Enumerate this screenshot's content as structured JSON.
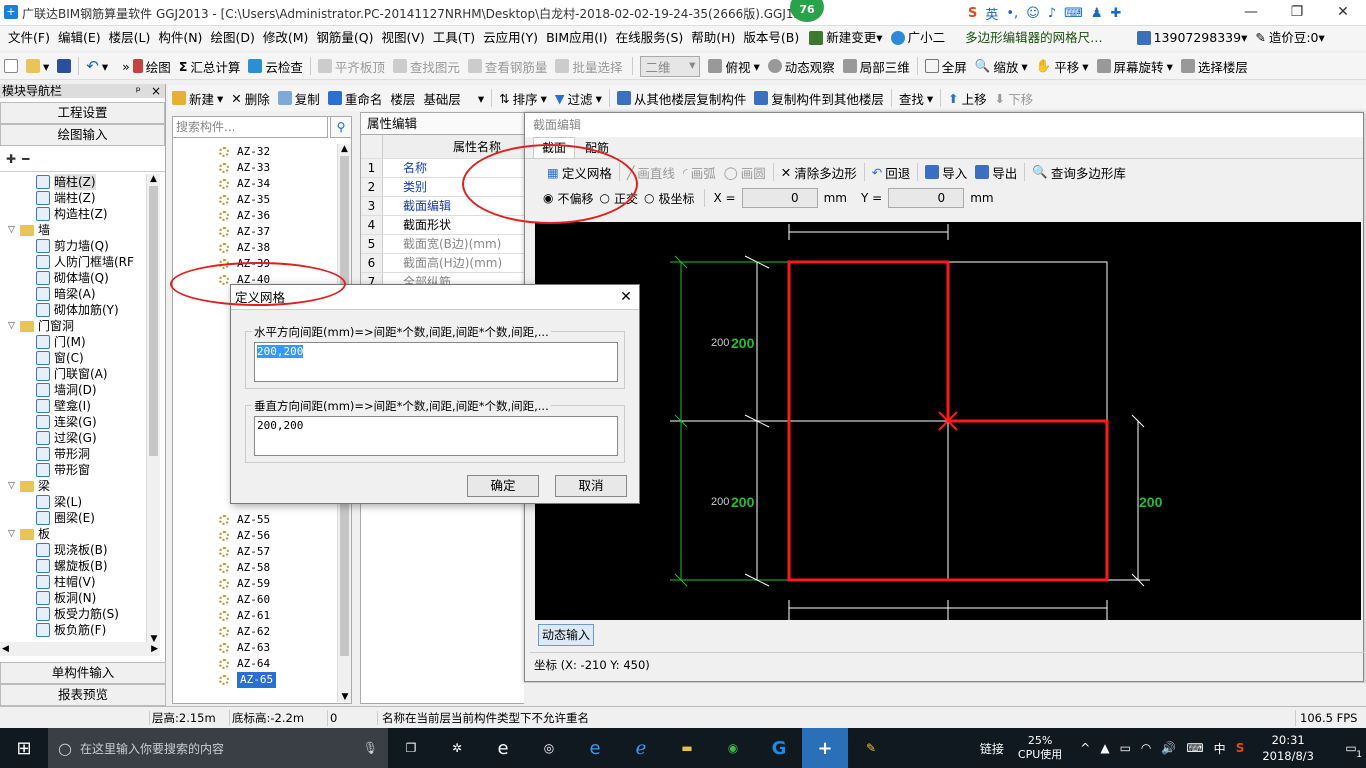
{
  "titlebar": {
    "title": "广联达BIM钢筋算量软件 GGJ2013 - [C:\\Users\\Administrator.PC-20141127NRHM\\Desktop\\白龙村-2018-02-02-19-24-35(2666版).GGJ12",
    "badge": "76",
    "minimize": "—",
    "maximize": "❐",
    "close": "✕"
  },
  "ime": {
    "lang": "英"
  },
  "menu": [
    "文件(F)",
    "编辑(E)",
    "楼层(L)",
    "构件(N)",
    "绘图(D)",
    "修改(M)",
    "钢筋量(Q)",
    "视图(V)",
    "工具(T)",
    "云应用(Y)",
    "BIM应用(I)",
    "在线服务(S)",
    "帮助(H)",
    "版本号(B)"
  ],
  "menu_right": {
    "change": "新建变更",
    "assistant": "广小二",
    "notice": "多边形编辑器的网格尺…",
    "phone": "13907298339",
    "price": "造价豆:0"
  },
  "toolbar1": {
    "draw": "绘图",
    "sum": "汇总计算",
    "cloud": "云检查",
    "flat": "平齐板顶",
    "find": "查找图元",
    "view_steel": "查看钢筋量",
    "batch": "批量选择",
    "view_mode": "二维",
    "top_view": "俯视",
    "dynamic": "动态观察",
    "local3d": "局部三维",
    "fullscreen": "全屏",
    "zoom": "缩放",
    "pan": "平移",
    "rotate": "屏幕旋转",
    "select_floor": "选择楼层"
  },
  "toolbar2": {
    "new": "新建",
    "delete": "删除",
    "copy": "复制",
    "rename": "重命名",
    "floor": "楼层",
    "floor_value": "基础层",
    "sort": "排序",
    "filter": "过滤",
    "copy_from": "从其他楼层复制构件",
    "copy_to": "复制构件到其他楼层",
    "search": "查找",
    "up": "上移",
    "down": "下移"
  },
  "nav": {
    "header": "模块导航栏",
    "pin": "ᵖ",
    "close": "×",
    "settings": "工程设置",
    "draw_input": "绘图输入",
    "single_input": "单构件输入",
    "report": "报表预览",
    "tree": [
      {
        "type": "item",
        "label": "暗柱(Z)",
        "sel": true
      },
      {
        "type": "item",
        "label": "端柱(Z)"
      },
      {
        "type": "item",
        "label": "构造柱(Z)"
      },
      {
        "type": "folder",
        "label": "墙"
      },
      {
        "type": "item",
        "label": "剪力墙(Q)"
      },
      {
        "type": "item",
        "label": "人防门框墙(RF"
      },
      {
        "type": "item",
        "label": "砌体墙(Q)"
      },
      {
        "type": "item",
        "label": "暗梁(A)"
      },
      {
        "type": "item",
        "label": "砌体加筋(Y)"
      },
      {
        "type": "folder",
        "label": "门窗洞"
      },
      {
        "type": "item",
        "label": "门(M)"
      },
      {
        "type": "item",
        "label": "窗(C)"
      },
      {
        "type": "item",
        "label": "门联窗(A)"
      },
      {
        "type": "item",
        "label": "墙洞(D)"
      },
      {
        "type": "item",
        "label": "壁龛(I)"
      },
      {
        "type": "item",
        "label": "连梁(G)"
      },
      {
        "type": "item",
        "label": "过梁(G)"
      },
      {
        "type": "item",
        "label": "带形洞"
      },
      {
        "type": "item",
        "label": "带形窗"
      },
      {
        "type": "folder",
        "label": "梁"
      },
      {
        "type": "item",
        "label": "梁(L)"
      },
      {
        "type": "item",
        "label": "圈梁(E)"
      },
      {
        "type": "folder",
        "label": "板"
      },
      {
        "type": "item",
        "label": "现浇板(B)"
      },
      {
        "type": "item",
        "label": "螺旋板(B)"
      },
      {
        "type": "item",
        "label": "柱帽(V)"
      },
      {
        "type": "item",
        "label": "板洞(N)"
      },
      {
        "type": "item",
        "label": "板受力筋(S)"
      },
      {
        "type": "item",
        "label": "板负筋(F)"
      }
    ]
  },
  "complist": {
    "placeholder": "搜索构件...",
    "items_top": [
      "AZ-32",
      "AZ-33",
      "AZ-34",
      "AZ-35",
      "AZ-36",
      "AZ-37",
      "AZ-38",
      "AZ-39",
      "AZ-40"
    ],
    "items_bottom": [
      "AZ-55",
      "AZ-56",
      "AZ-57",
      "AZ-58",
      "AZ-59",
      "AZ-60",
      "AZ-61",
      "AZ-62",
      "AZ-63",
      "AZ-64",
      "AZ-65"
    ],
    "selected": "AZ-65"
  },
  "props": {
    "tab": "属性编辑",
    "header": "属性名称",
    "rows": [
      {
        "n": "1",
        "v": "名称",
        "c": "blue"
      },
      {
        "n": "2",
        "v": "类别",
        "c": "blue"
      },
      {
        "n": "3",
        "v": "截面编辑",
        "c": "blue"
      },
      {
        "n": "4",
        "v": "截面形状",
        "c": ""
      },
      {
        "n": "5",
        "v": "截面宽(B边)(mm)",
        "c": "gray"
      },
      {
        "n": "6",
        "v": "截面高(H边)(mm)",
        "c": "gray"
      },
      {
        "n": "7",
        "v": "全部纵筋",
        "c": "gray"
      }
    ]
  },
  "secwin": {
    "title": "截面编辑",
    "tab1": "截面",
    "tab2": "配筋",
    "define_grid": "定义网格",
    "draw_line": "画直线",
    "draw_arc": "画弧",
    "draw_circle": "画圆",
    "clear": "清除多边形",
    "undo": "回退",
    "import": "导入",
    "export": "导出",
    "query": "查询多边形库",
    "no_offset": "不偏移",
    "ortho": "正交",
    "polar": "极坐标",
    "x_label": "X =",
    "x_val": "0",
    "y_label": "Y =",
    "y_val": "0",
    "unit": "mm",
    "dyn_input": "动态输入",
    "coord": "坐标 (X: -210 Y: 450)"
  },
  "canvas": {
    "dims": [
      "200",
      "200",
      "200",
      "200",
      "200",
      "200"
    ]
  },
  "dialog": {
    "title": "定义网格",
    "close": "✕",
    "h_label": "水平方向间距(mm)=>间距*个数,间距,间距*个数,间距,...",
    "h_value": "200,200",
    "v_label": "垂直方向间距(mm)=>间距*个数,间距,间距*个数,间距,...",
    "v_value": "200,200",
    "ok": "确定",
    "cancel": "取消"
  },
  "status": {
    "floor_h": "层高:2.15m",
    "base_h": "底标高:-2.2m",
    "zero": "0",
    "msg": "名称在当前层当前构件类型下不允许重名",
    "fps": "106.5 FPS"
  },
  "taskbar": {
    "search": "在这里输入你要搜索的内容",
    "link": "链接",
    "cpu_pct": "25%",
    "cpu": "CPU使用",
    "ime": "中",
    "time": "20:31",
    "date": "2018/8/3",
    "notif": "1"
  }
}
